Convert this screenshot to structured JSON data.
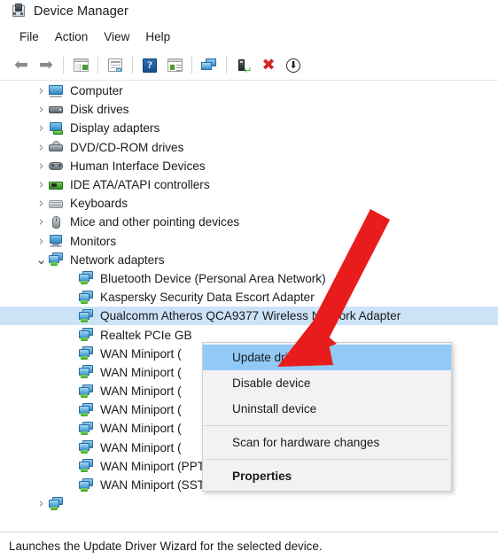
{
  "window": {
    "title": "Device Manager",
    "icon": "device-manager-icon"
  },
  "menubar": {
    "items": [
      {
        "label": "File"
      },
      {
        "label": "Action"
      },
      {
        "label": "View"
      },
      {
        "label": "Help"
      }
    ]
  },
  "toolbar": {
    "buttons": [
      {
        "icon": "back-arrow-icon",
        "tooltip": "Back"
      },
      {
        "icon": "forward-arrow-icon",
        "tooltip": "Forward"
      },
      {
        "icon": "show-hide-console-tree-icon",
        "tooltip": "Show/Hide Console Tree"
      },
      {
        "icon": "properties-icon",
        "tooltip": "Properties"
      },
      {
        "icon": "help-icon",
        "tooltip": "Help"
      },
      {
        "icon": "show-hide-action-pane-icon",
        "tooltip": "Show/Hide Action Pane"
      },
      {
        "icon": "update-driver-monitor-icon",
        "tooltip": "Update Driver Software"
      },
      {
        "icon": "scan-for-hardware-changes-icon",
        "tooltip": "Scan for hardware changes"
      },
      {
        "icon": "uninstall-device-icon",
        "tooltip": "Uninstall device"
      },
      {
        "icon": "disable-device-icon",
        "tooltip": "Disable device"
      }
    ]
  },
  "tree": {
    "nodes": [
      {
        "label": "Computer",
        "icon": "computer-icon",
        "expander": "collapsed",
        "level": 1,
        "selected": false
      },
      {
        "label": "Disk drives",
        "icon": "disk-drive-icon",
        "expander": "collapsed",
        "level": 1,
        "selected": false
      },
      {
        "label": "Display adapters",
        "icon": "display-adapter-icon",
        "expander": "collapsed",
        "level": 1,
        "selected": false
      },
      {
        "label": "DVD/CD-ROM drives",
        "icon": "dvd-drive-icon",
        "expander": "collapsed",
        "level": 1,
        "selected": false
      },
      {
        "label": "Human Interface Devices",
        "icon": "hid-icon",
        "expander": "collapsed",
        "level": 1,
        "selected": false
      },
      {
        "label": "IDE ATA/ATAPI controllers",
        "icon": "ide-controller-icon",
        "expander": "collapsed",
        "level": 1,
        "selected": false
      },
      {
        "label": "Keyboards",
        "icon": "keyboard-icon",
        "expander": "collapsed",
        "level": 1,
        "selected": false
      },
      {
        "label": "Mice and other pointing devices",
        "icon": "mouse-icon",
        "expander": "collapsed",
        "level": 1,
        "selected": false
      },
      {
        "label": "Monitors",
        "icon": "monitor-icon",
        "expander": "collapsed",
        "level": 1,
        "selected": false
      },
      {
        "label": "Network adapters",
        "icon": "network-adapter-icon",
        "expander": "expanded",
        "level": 1,
        "selected": false
      },
      {
        "label": "Bluetooth Device (Personal Area Network)",
        "icon": "network-adapter-icon",
        "expander": "none",
        "level": 2,
        "selected": false
      },
      {
        "label": "Kaspersky Security Data Escort Adapter",
        "icon": "network-adapter-icon",
        "expander": "none",
        "level": 2,
        "selected": false
      },
      {
        "label": "Qualcomm Atheros QCA9377 Wireless Network Adapter",
        "icon": "network-adapter-icon",
        "expander": "none",
        "level": 2,
        "selected": true
      },
      {
        "label": "Realtek PCIe GB",
        "icon": "network-adapter-icon",
        "expander": "none",
        "level": 2,
        "selected": false
      },
      {
        "label": "WAN Miniport (",
        "icon": "network-adapter-icon",
        "expander": "none",
        "level": 2,
        "selected": false
      },
      {
        "label": "WAN Miniport (",
        "icon": "network-adapter-icon",
        "expander": "none",
        "level": 2,
        "selected": false
      },
      {
        "label": "WAN Miniport (",
        "icon": "network-adapter-icon",
        "expander": "none",
        "level": 2,
        "selected": false
      },
      {
        "label": "WAN Miniport (",
        "icon": "network-adapter-icon",
        "expander": "none",
        "level": 2,
        "selected": false
      },
      {
        "label": "WAN Miniport (",
        "icon": "network-adapter-icon",
        "expander": "none",
        "level": 2,
        "selected": false
      },
      {
        "label": "WAN Miniport (",
        "icon": "network-adapter-icon",
        "expander": "none",
        "level": 2,
        "selected": false
      },
      {
        "label": "WAN Miniport (PPTP)",
        "icon": "network-adapter-icon",
        "expander": "none",
        "level": 2,
        "selected": false
      },
      {
        "label": "WAN Miniport (SSTP)",
        "icon": "network-adapter-icon",
        "expander": "none",
        "level": 2,
        "selected": false
      },
      {
        "label": "",
        "icon": "network-adapter-icon",
        "expander": "collapsed",
        "level": 1,
        "selected": false
      }
    ]
  },
  "context_menu": {
    "items": [
      {
        "label": "Update driver",
        "type": "item",
        "highlighted": true,
        "bold": false
      },
      {
        "label": "Disable device",
        "type": "item",
        "highlighted": false,
        "bold": false
      },
      {
        "label": "Uninstall device",
        "type": "item",
        "highlighted": false,
        "bold": false
      },
      {
        "label": "",
        "type": "separator",
        "highlighted": false,
        "bold": false
      },
      {
        "label": "Scan for hardware changes",
        "type": "item",
        "highlighted": false,
        "bold": false
      },
      {
        "label": "",
        "type": "separator",
        "highlighted": false,
        "bold": false
      },
      {
        "label": "Properties",
        "type": "item",
        "highlighted": false,
        "bold": true
      }
    ]
  },
  "annotation": {
    "type": "arrow",
    "color": "#e81c1c",
    "points_to": "Update driver"
  },
  "statusbar": {
    "text": "Launches the Update Driver Wizard for the selected device."
  },
  "colors": {
    "selection": "#cce3f7",
    "menu_highlight": "#91c9f7",
    "menu_background": "#f2f2f2",
    "annotation_red": "#e81c1c",
    "text": "#1b1b1b"
  }
}
